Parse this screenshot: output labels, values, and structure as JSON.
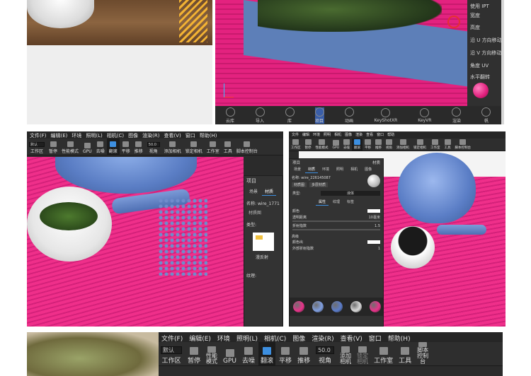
{
  "top_right": {
    "sidebar_items": [
      "使用 IPT",
      "宽度",
      "高度",
      "沿 U 方向移动",
      "沿 V 方向移动",
      "角度 UV",
      "水平翻转"
    ],
    "nav": [
      "云库",
      "导入",
      "库",
      "项目",
      "动画",
      "KeyShotXR",
      "KeyVR",
      "渲染"
    ],
    "nav_active": 3,
    "last_partial": "帆"
  },
  "mid_left": {
    "menu": [
      "文件(F)",
      "编辑(E)",
      "环境",
      "照明(L)",
      "相机(C)",
      "图像",
      "渲染(R)",
      "查看(V)",
      "窗口",
      "帮助(H)"
    ],
    "toolbar": [
      "工作区",
      "暂停",
      "性能模式",
      "GPU",
      "去噪",
      "翻滚",
      "平移",
      "推移",
      "视角",
      "添加相机",
      "锁定相机",
      "工作室",
      "工具",
      "脚本控制台"
    ],
    "workspace_value": "默认",
    "fov_value": "50.0",
    "panel": {
      "header": "项目",
      "tabs": [
        "场景",
        "材质"
      ],
      "name_label": "名称:",
      "name_value": "wire_1771",
      "child_label": "材质图",
      "type_label": "类型:",
      "preview_label": "漫反射",
      "texture_label": "纹理:"
    }
  },
  "mid_right": {
    "menu": [
      "文件",
      "编辑",
      "环境",
      "照明",
      "相机",
      "图像",
      "渲染",
      "查看",
      "窗口",
      "帮助"
    ],
    "toolbar": [
      "工作区",
      "暂停",
      "性能模式",
      "GPU",
      "去噪",
      "翻滚",
      "平移",
      "推移",
      "视角",
      "添加相机",
      "锁定相机",
      "工作室",
      "工具",
      "脚本控制台"
    ],
    "panel": {
      "header": "项目",
      "header_right": "材质",
      "tabs": [
        "场景",
        "材质",
        "环境",
        "照明",
        "相机",
        "图像"
      ],
      "name_label": "名称:",
      "name_value": "wire_226145087",
      "btn_graph": "材质图",
      "btn_multi": "多层材质",
      "type_label": "类型:",
      "type_value": "液体",
      "subtabs": [
        "属性",
        "纹理",
        "标签"
      ],
      "props": [
        {
          "label": "颜色",
          "value": ""
        },
        {
          "label": "透明距离",
          "value": "10毫米"
        },
        {
          "label": "折射指数",
          "value": "1.5"
        }
      ],
      "advanced_label": "高级",
      "adv_props": [
        {
          "label": "颜色出",
          "value": ""
        },
        {
          "label": "外部折射指数",
          "value": "1"
        }
      ],
      "swatch_colors": [
        "#e8338a",
        "#7f9ee0",
        "#5b7cc9",
        "#d8d8d8",
        "#e8338a"
      ]
    }
  },
  "bottom": {
    "menu": [
      "文件(F)",
      "编辑(E)",
      "环境",
      "照明(L)",
      "相机(C)",
      "图像",
      "渲染(R)",
      "查看(V)",
      "窗口",
      "帮助(H)"
    ],
    "toolbar": [
      "工作区",
      "暂停",
      "性能模式",
      "GPU",
      "去噪",
      "翻滚",
      "平移",
      "推移",
      "视角",
      "添加相机",
      "锁定相机",
      "工作室",
      "工具",
      "脚本控制台"
    ],
    "workspace_value": "默认",
    "fov_value": "50.0"
  }
}
